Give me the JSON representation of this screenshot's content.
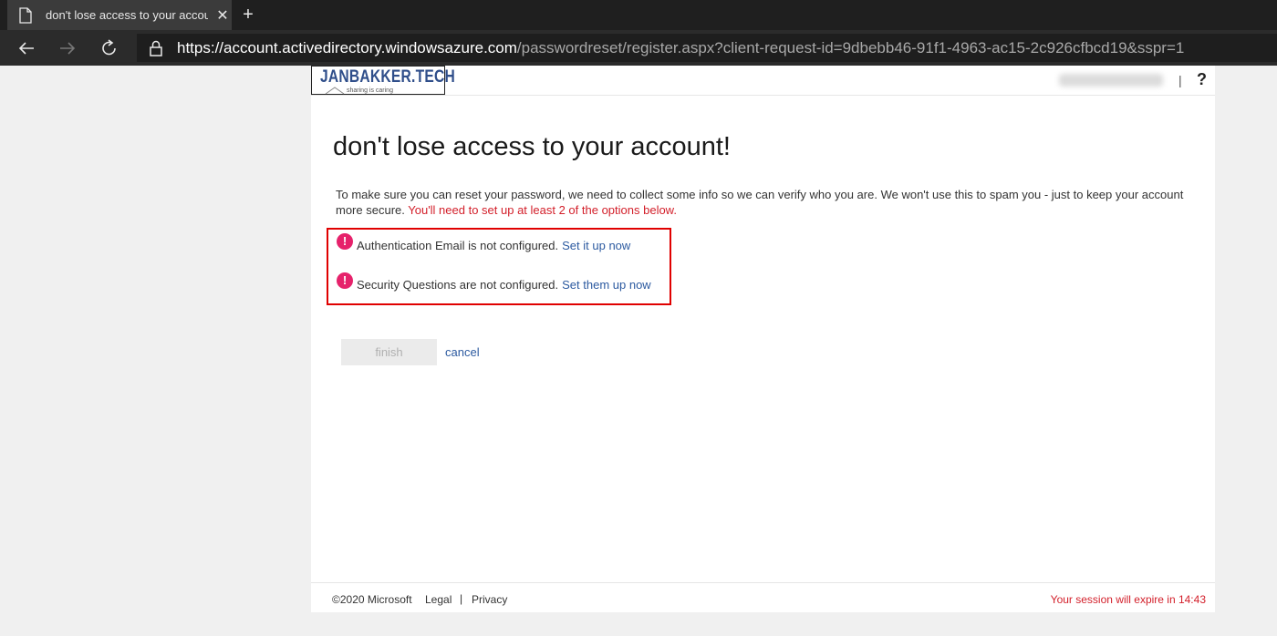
{
  "browser": {
    "tab_title": "don't lose access to your account!",
    "tab_close": "✕",
    "new_tab": "+",
    "url_host": "https://account.activedirectory.windowsazure.com",
    "url_rest": "/passwordreset/register.aspx?client-request-id=9dbebb46-91f1-4963-ac15-2c926cfbcd19&sspr=1",
    "icons": [
      "page-icon",
      "back-icon",
      "forward-icon",
      "refresh-icon",
      "lock-icon"
    ]
  },
  "header": {
    "logo_text": "JANBAKKER.TECH",
    "logo_tagline": "sharing is caring",
    "separator": "|",
    "help": "?"
  },
  "main": {
    "title": "don't lose access to your account!",
    "intro_text": "To make sure you can reset your password, we need to collect some info so we can verify who you are. We won't use this to spam you - just to keep your account more secure. ",
    "intro_warning": "You'll need to set up at least 2 of the options below.",
    "items": [
      {
        "status_icon": "!",
        "text": "Authentication Email is not configured.",
        "link": "Set it up now"
      },
      {
        "status_icon": "!",
        "text": "Security Questions are not configured.",
        "link": "Set them up now"
      }
    ],
    "finish_label": "finish",
    "cancel_label": "cancel"
  },
  "footer": {
    "copyright": "©2020 Microsoft",
    "legal": "Legal",
    "separator": "|",
    "privacy": "Privacy",
    "session_text": "Your session will expire in 14:43"
  },
  "colors": {
    "warning_badge": "#e6226b",
    "link": "#2c5aa0",
    "alert_text": "#d3202b",
    "highlight_border": "#e00000"
  }
}
